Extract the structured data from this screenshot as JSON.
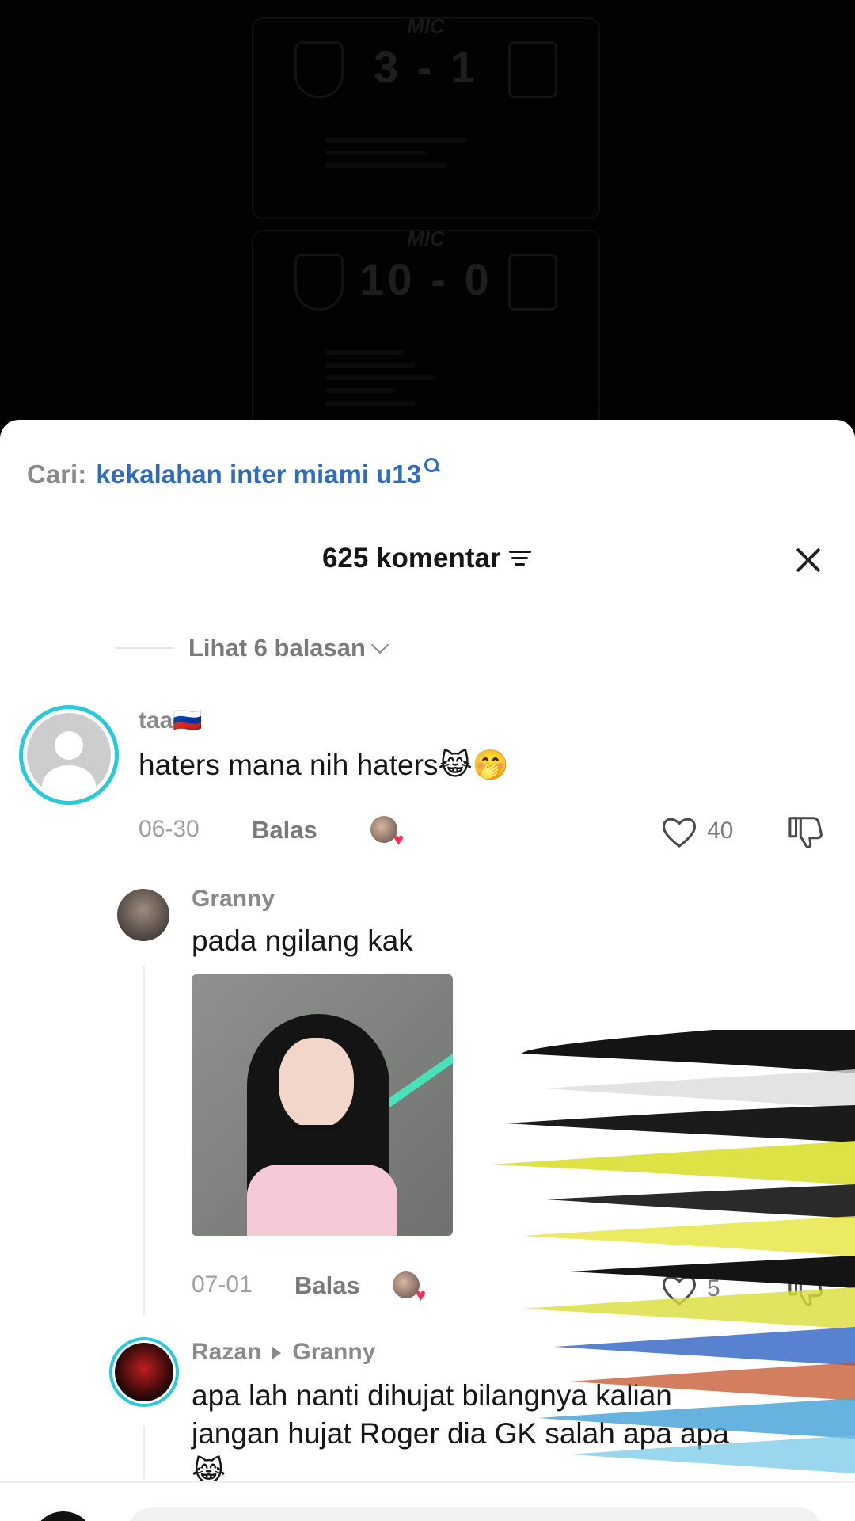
{
  "video": {
    "scoreboard_1": {
      "brand": "MIC",
      "score": "3 - 1"
    },
    "scoreboard_2": {
      "brand": "MIC",
      "score": "10 - 0"
    }
  },
  "search": {
    "label": "Cari:",
    "term": "kekalahan inter miami u13",
    "icon": "search-icon"
  },
  "header": {
    "title": "625 komentar",
    "sort_icon": "sort-icon",
    "close_icon": "close-icon"
  },
  "replies_toggle": {
    "label": "Lihat 6 balasan",
    "icon": "chevron-down-icon"
  },
  "comments": [
    {
      "username": "taa🇷🇺",
      "text": "haters mana nih haters😹🤭",
      "date": "06-30",
      "reply_label": "Balas",
      "likes": "40",
      "avatar_ring_color": "#27c9dd"
    },
    {
      "username": "Granny",
      "text": "pada ngilang kak",
      "date": "07-01",
      "reply_label": "Balas",
      "likes": "5"
    },
    {
      "username": "Razan",
      "reply_to": "Granny",
      "text_line1": "apa lah nanti dihujat bilangnya kalian",
      "text_line2": "jangan hujat Roger dia GK salah apa apa",
      "text_line3": "😹",
      "avatar_ring_color": "#27c9dd"
    }
  ],
  "colors": {
    "accent_link": "#2f6cc0",
    "heart": "#fe2c55"
  }
}
